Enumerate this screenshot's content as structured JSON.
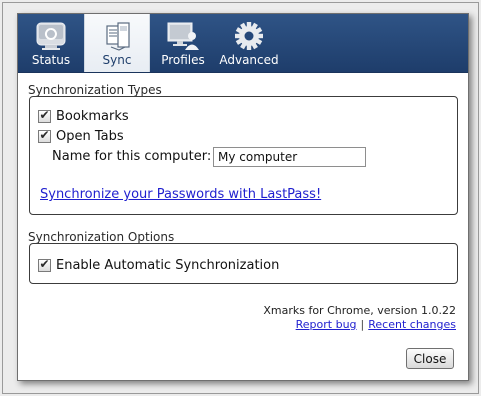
{
  "tabs": [
    {
      "label": "Status",
      "icon": "status-icon",
      "active": false
    },
    {
      "label": "Sync",
      "icon": "sync-icon",
      "active": true
    },
    {
      "label": "Profiles",
      "icon": "profiles-icon",
      "active": false
    },
    {
      "label": "Advanced",
      "icon": "gear-icon",
      "active": false
    }
  ],
  "sync_types": {
    "title": "Synchronization Types",
    "bookmarks": {
      "label": "Bookmarks",
      "checked": true
    },
    "open_tabs": {
      "label": "Open Tabs",
      "checked": true
    },
    "computer_name_label": "Name for this computer:",
    "computer_name_value": "My computer",
    "lastpass_link": "Synchronize your Passwords with LastPass!"
  },
  "sync_options": {
    "title": "Synchronization Options",
    "auto_sync": {
      "label": "Enable Automatic Synchronization",
      "checked": true
    }
  },
  "footer": {
    "version": "Xmarks for Chrome, version 1.0.22",
    "report_bug": "Report bug",
    "separator": "|",
    "recent_changes": "Recent changes"
  },
  "buttons": {
    "close": "Close"
  },
  "colors": {
    "tabbar": "#244779",
    "link": "#1f1fcf"
  }
}
